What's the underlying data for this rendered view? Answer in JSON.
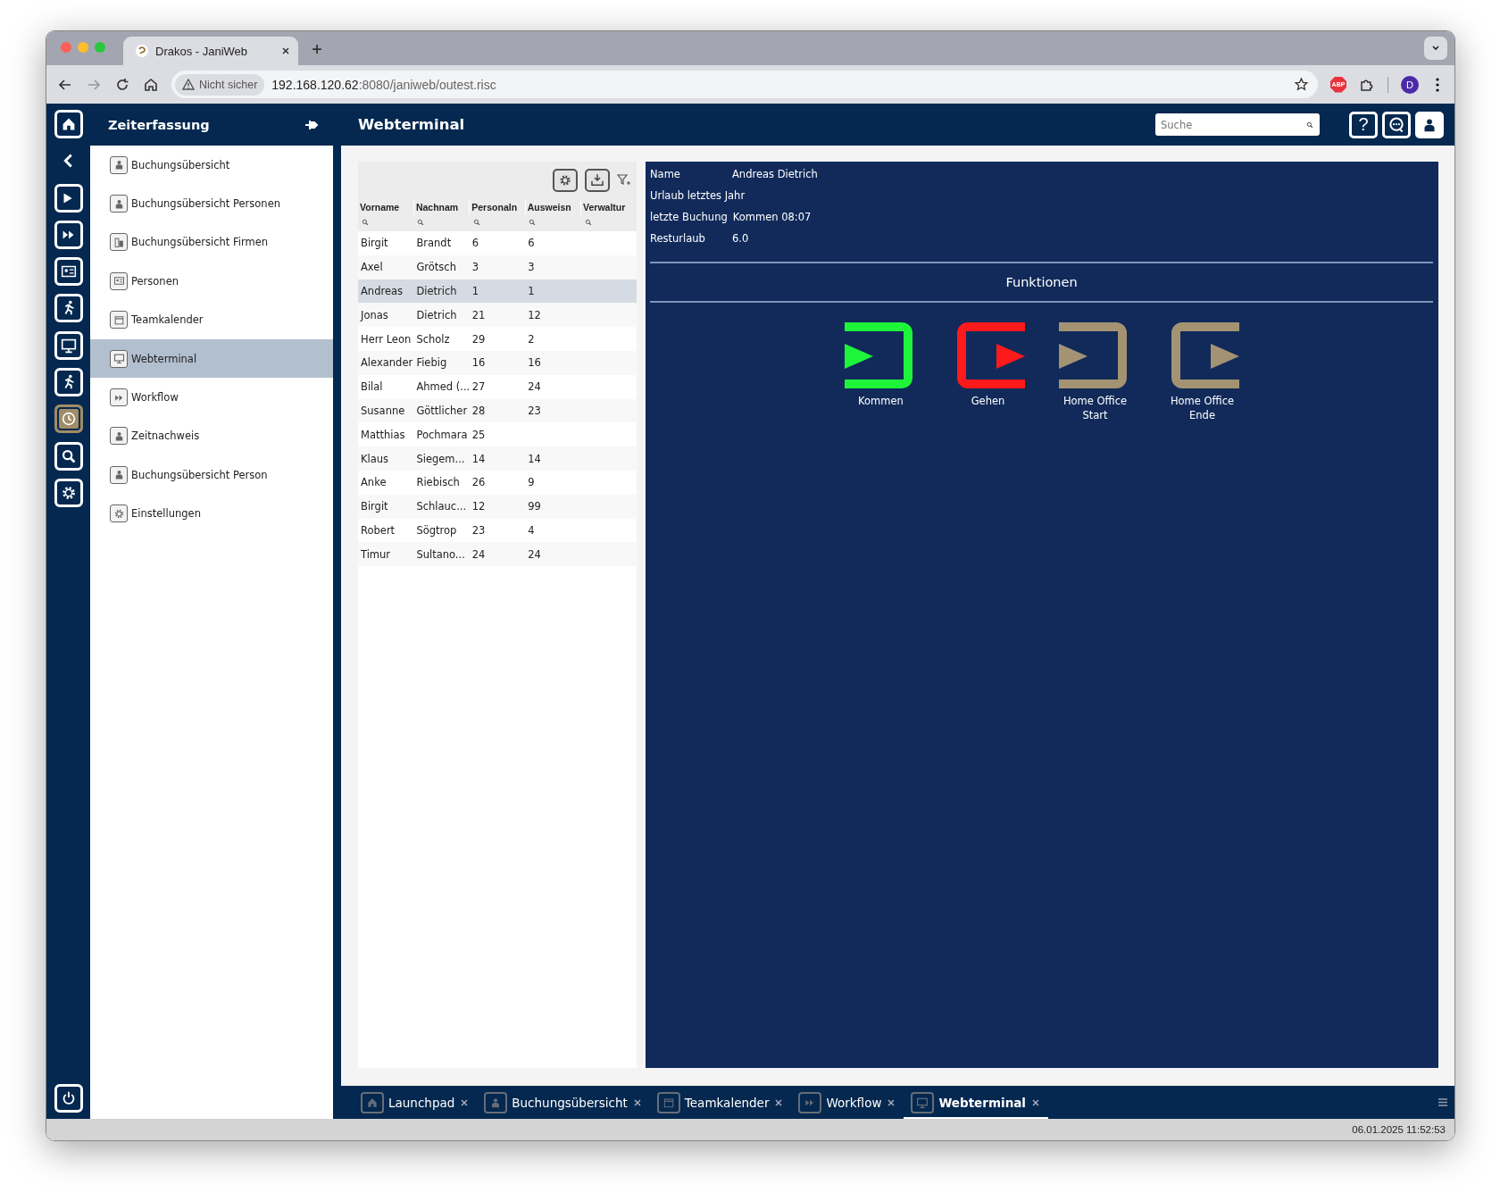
{
  "browser": {
    "tab_title": "Drakos - JaniWeb",
    "security": "Nicht sicher",
    "url_host": "192.168.120.62",
    "url_path": ":8080/janiweb/outest.risc",
    "extension_badge": "ABP",
    "profile": "D"
  },
  "header": {
    "section": "Zeiterfassung",
    "title": "Webterminal",
    "search": {
      "placeholder": "Suche"
    },
    "help": "?"
  },
  "rail": {
    "items": [
      {
        "selected": false
      },
      {
        "selected": false
      },
      {
        "selected": false
      },
      {
        "selected": false
      },
      {
        "selected": false
      },
      {
        "selected": false
      },
      {
        "selected": false
      },
      {
        "selected": false
      },
      {
        "selected": true
      },
      {
        "selected": false
      },
      {
        "selected": false
      }
    ]
  },
  "sidebar": {
    "items": [
      {
        "label": "Buchungsübersicht",
        "selected": false
      },
      {
        "label": "Buchungsübersicht Personen",
        "selected": false
      },
      {
        "label": "Buchungsübersicht Firmen",
        "selected": false
      },
      {
        "label": "Personen",
        "selected": false
      },
      {
        "label": "Teamkalender",
        "selected": false
      },
      {
        "label": "Webterminal",
        "selected": true
      },
      {
        "label": "Workflow",
        "selected": false
      },
      {
        "label": "Zeitnachweis",
        "selected": false
      },
      {
        "label": "Buchungsübersicht Person",
        "selected": false
      },
      {
        "label": "Einstellungen",
        "selected": false
      }
    ]
  },
  "table": {
    "columns": [
      "Vorname",
      "Nachnam",
      "Personaln",
      "Ausweisn",
      "Verwaltur"
    ],
    "rows": [
      {
        "cells": [
          "Birgit",
          "Brandt",
          "6",
          "6"
        ],
        "selected": false
      },
      {
        "cells": [
          "Axel",
          "Grötsch",
          "3",
          "3"
        ],
        "selected": false
      },
      {
        "cells": [
          "Andreas",
          "Dietrich",
          "1",
          "1"
        ],
        "selected": true
      },
      {
        "cells": [
          "Jonas",
          "Dietrich",
          "21",
          "12"
        ],
        "selected": false
      },
      {
        "cells": [
          "Herr Leon",
          "Scholz",
          "29",
          "2"
        ],
        "selected": false
      },
      {
        "cells": [
          "Alexander",
          "Fiebig",
          "16",
          "16"
        ],
        "selected": false
      },
      {
        "cells": [
          "Bilal",
          "Ahmed (...",
          "27",
          "24"
        ],
        "selected": false
      },
      {
        "cells": [
          "Susanne",
          "Göttlicher",
          "28",
          "23"
        ],
        "selected": false
      },
      {
        "cells": [
          "Matthias",
          "Pochmara",
          "25"
        ],
        "selected": false
      },
      {
        "cells": [
          "Klaus",
          "Siegem...",
          "14",
          "14"
        ],
        "selected": false
      },
      {
        "cells": [
          "Anke",
          "Riebisch",
          "26",
          "9"
        ],
        "selected": false
      },
      {
        "cells": [
          "Birgit",
          "Schlauc...",
          "12",
          "99"
        ],
        "selected": false
      },
      {
        "cells": [
          "Robert",
          "Sögtrop",
          "23",
          "4"
        ],
        "selected": false
      },
      {
        "cells": [
          "Timur",
          "Sultano...",
          "24",
          "24"
        ],
        "selected": false
      }
    ]
  },
  "details": {
    "fields": [
      {
        "label": "Name",
        "value": "Andreas Dietrich"
      },
      {
        "label": "Urlaub letztes Jahr"
      },
      {
        "label": "letzte Buchung",
        "value": "Kommen 08:07"
      },
      {
        "label": "Resturlaub",
        "value": "6.0"
      }
    ]
  },
  "functions": {
    "title": "Funktionen",
    "buttons": [
      {
        "label": "Kommen",
        "kind": "enter",
        "color": "#1ef53a"
      },
      {
        "label": "Gehen",
        "kind": "leave",
        "color": "#fd1a1a"
      },
      {
        "label": "Home Office Start",
        "kind": "enter",
        "color": "#a39373"
      },
      {
        "label": "Home Office Ende",
        "kind": "leave",
        "color": "#a39373"
      }
    ]
  },
  "bottom_tabs": [
    {
      "label": "Launchpad",
      "selected": false
    },
    {
      "label": "Buchungsübersicht",
      "selected": false
    },
    {
      "label": "Teamkalender",
      "selected": false
    },
    {
      "label": "Workflow",
      "selected": false
    },
    {
      "label": "Webterminal",
      "selected": true
    }
  ],
  "status_bar": {
    "timestamp": "06.01.2025 11:52:53"
  }
}
